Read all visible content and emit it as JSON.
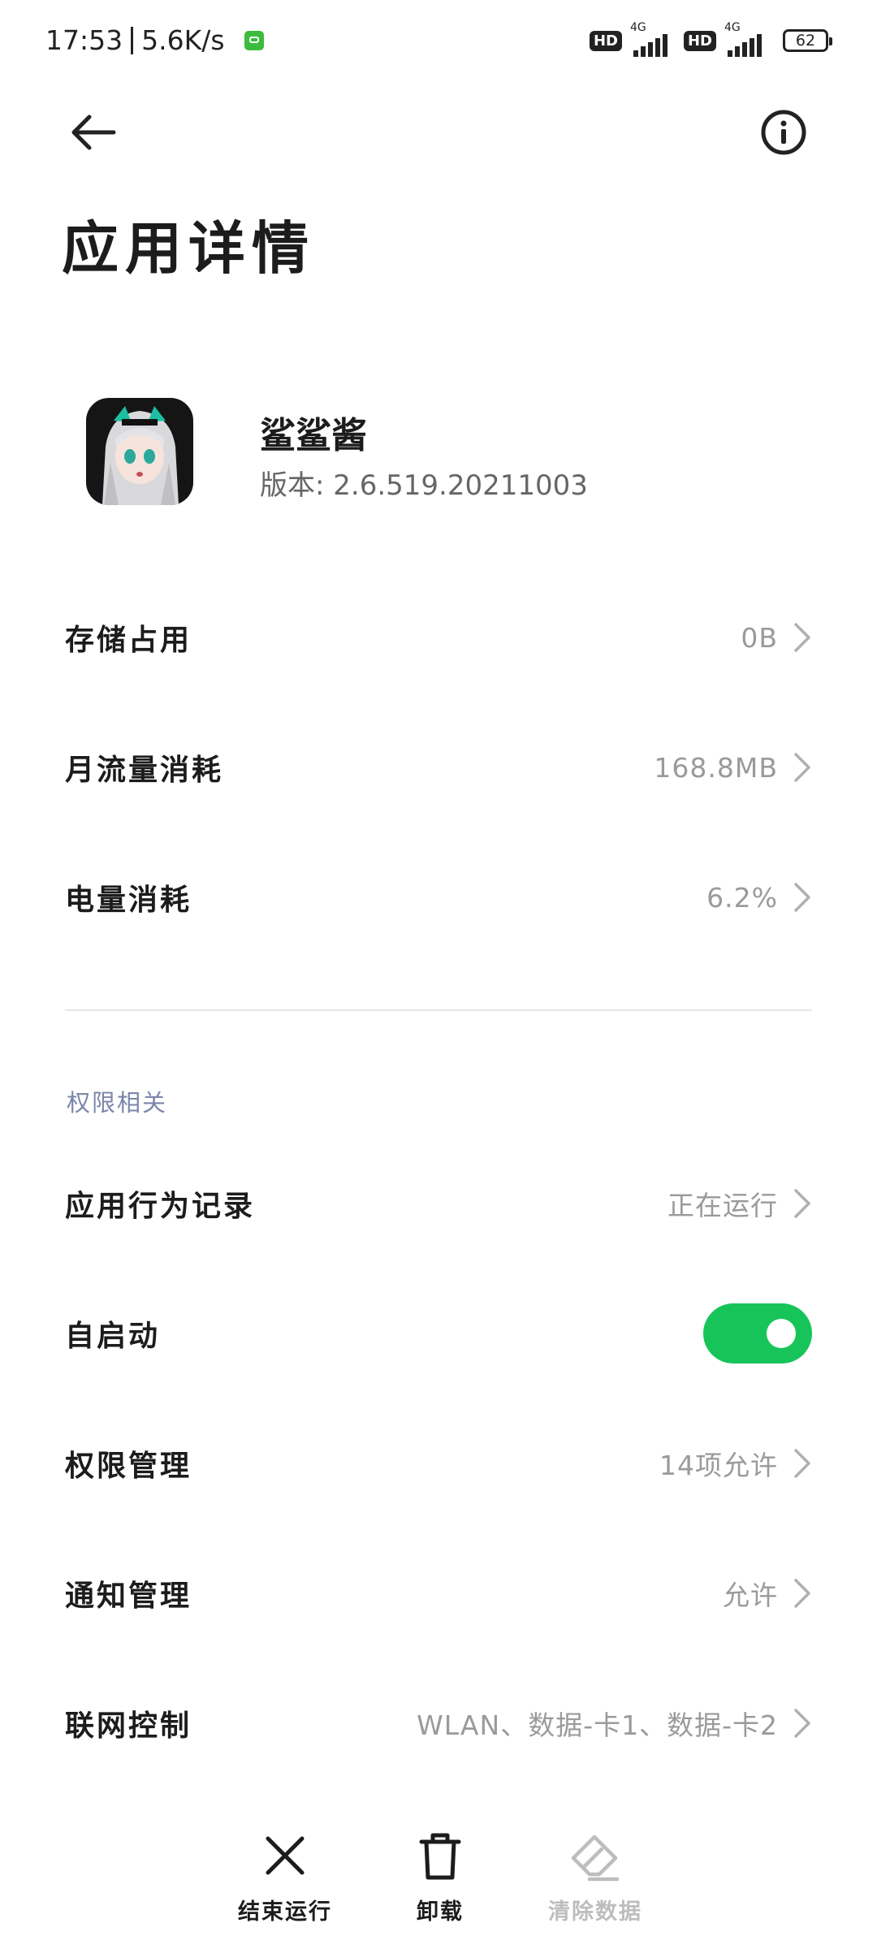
{
  "status_bar": {
    "time": "17:53",
    "speed": "5.6K/s",
    "hd1": "HD",
    "net1": "4G",
    "hd2": "HD",
    "net2": "4G",
    "battery": "62"
  },
  "header": {
    "back_icon": "arrow-left-icon",
    "info_icon": "info-icon",
    "title": "应用详情"
  },
  "app": {
    "name": "鲨鲨酱",
    "version": "版本: 2.6.519.20211003"
  },
  "usage": [
    {
      "label": "存储占用",
      "value": "0B"
    },
    {
      "label": "月流量消耗",
      "value": "168.8MB"
    },
    {
      "label": "电量消耗",
      "value": "6.2%"
    }
  ],
  "permissions_section": {
    "title": "权限相关",
    "behavior_log": {
      "label": "应用行为记录",
      "value": "正在运行"
    },
    "auto_start": {
      "label": "自启动",
      "enabled": true
    },
    "permission_mgmt": {
      "label": "权限管理",
      "value": "14项允许"
    },
    "notification_mgmt": {
      "label": "通知管理",
      "value": "允许"
    },
    "network_control": {
      "label": "联网控制",
      "value": "WLAN、数据-卡1、数据-卡2"
    }
  },
  "toolbar": {
    "force_stop": "结束运行",
    "uninstall": "卸载",
    "clear_data": "清除数据"
  },
  "colors": {
    "accent": "#17c45a",
    "section_title": "#7b86a9",
    "muted": "#9a9a9a",
    "disabled": "#bdbdbd"
  }
}
